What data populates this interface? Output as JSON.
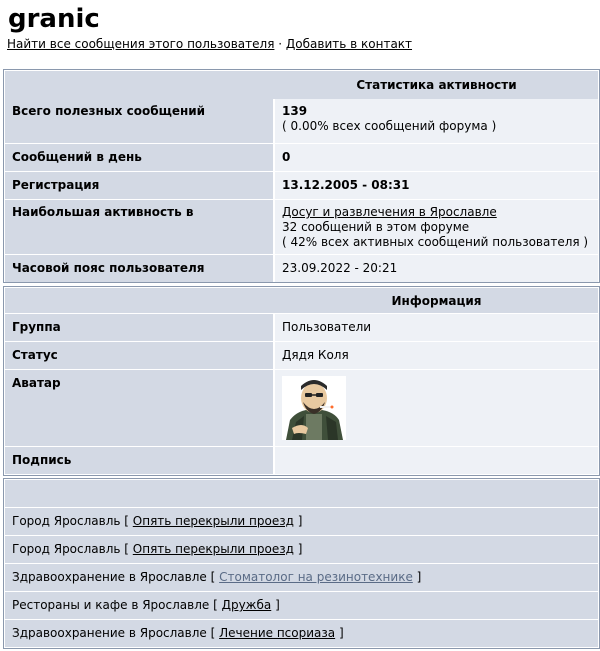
{
  "profile": {
    "username": "granic",
    "find_posts_link": "Найти все сообщения этого пользователя",
    "separator": "·",
    "add_contact_link": "Добавить в контакт"
  },
  "stats": {
    "header": "Статистика активности",
    "total_label": "Всего полезных сообщений",
    "total_value": "139",
    "total_percent": "( 0.00% всех сообщений форума )",
    "per_day_label": "Сообщений в день",
    "per_day_value": "0",
    "registration_label": "Регистрация",
    "registration_value": "13.12.2005 - 08:31",
    "most_active_label": "Наибольшая активность в",
    "most_active_forum": "Досуг и развлечения в Ярославле",
    "most_active_count": "32 сообщений в этом форуме",
    "most_active_percent": "( 42% всех активных сообщений пользователя )",
    "timezone_label": "Часовой пояс пользователя",
    "timezone_value": "23.09.2022 - 20:21"
  },
  "info": {
    "header": "Информация",
    "group_label": "Группа",
    "group_value": "Пользователи",
    "status_label": "Статус",
    "status_value": "Дядя Коля",
    "avatar_label": "Аватар",
    "avatar_icon": "cartoon-man-avatar-icon",
    "signature_label": "Подпись"
  },
  "recent_posts": [
    {
      "forum": "Город Ярославль",
      "topic": "Опять перекрыли проезд",
      "visited": false
    },
    {
      "forum": "Город Ярославль",
      "topic": "Опять перекрыли проезд",
      "visited": false
    },
    {
      "forum": "Здравоохранение в Ярославле",
      "topic": "Стоматолог на резинотехнике",
      "visited": true
    },
    {
      "forum": "Рестораны и кафе в Ярославле",
      "topic": "Дружба",
      "visited": false
    },
    {
      "forum": "Здравоохранение в Ярославле",
      "topic": "Лечение псориаза",
      "visited": false
    }
  ],
  "colors": {
    "label_bg": "#d3d9e4",
    "value_bg": "#eef1f6",
    "border": "#8a98ad",
    "visited_link": "#5a6b86"
  }
}
